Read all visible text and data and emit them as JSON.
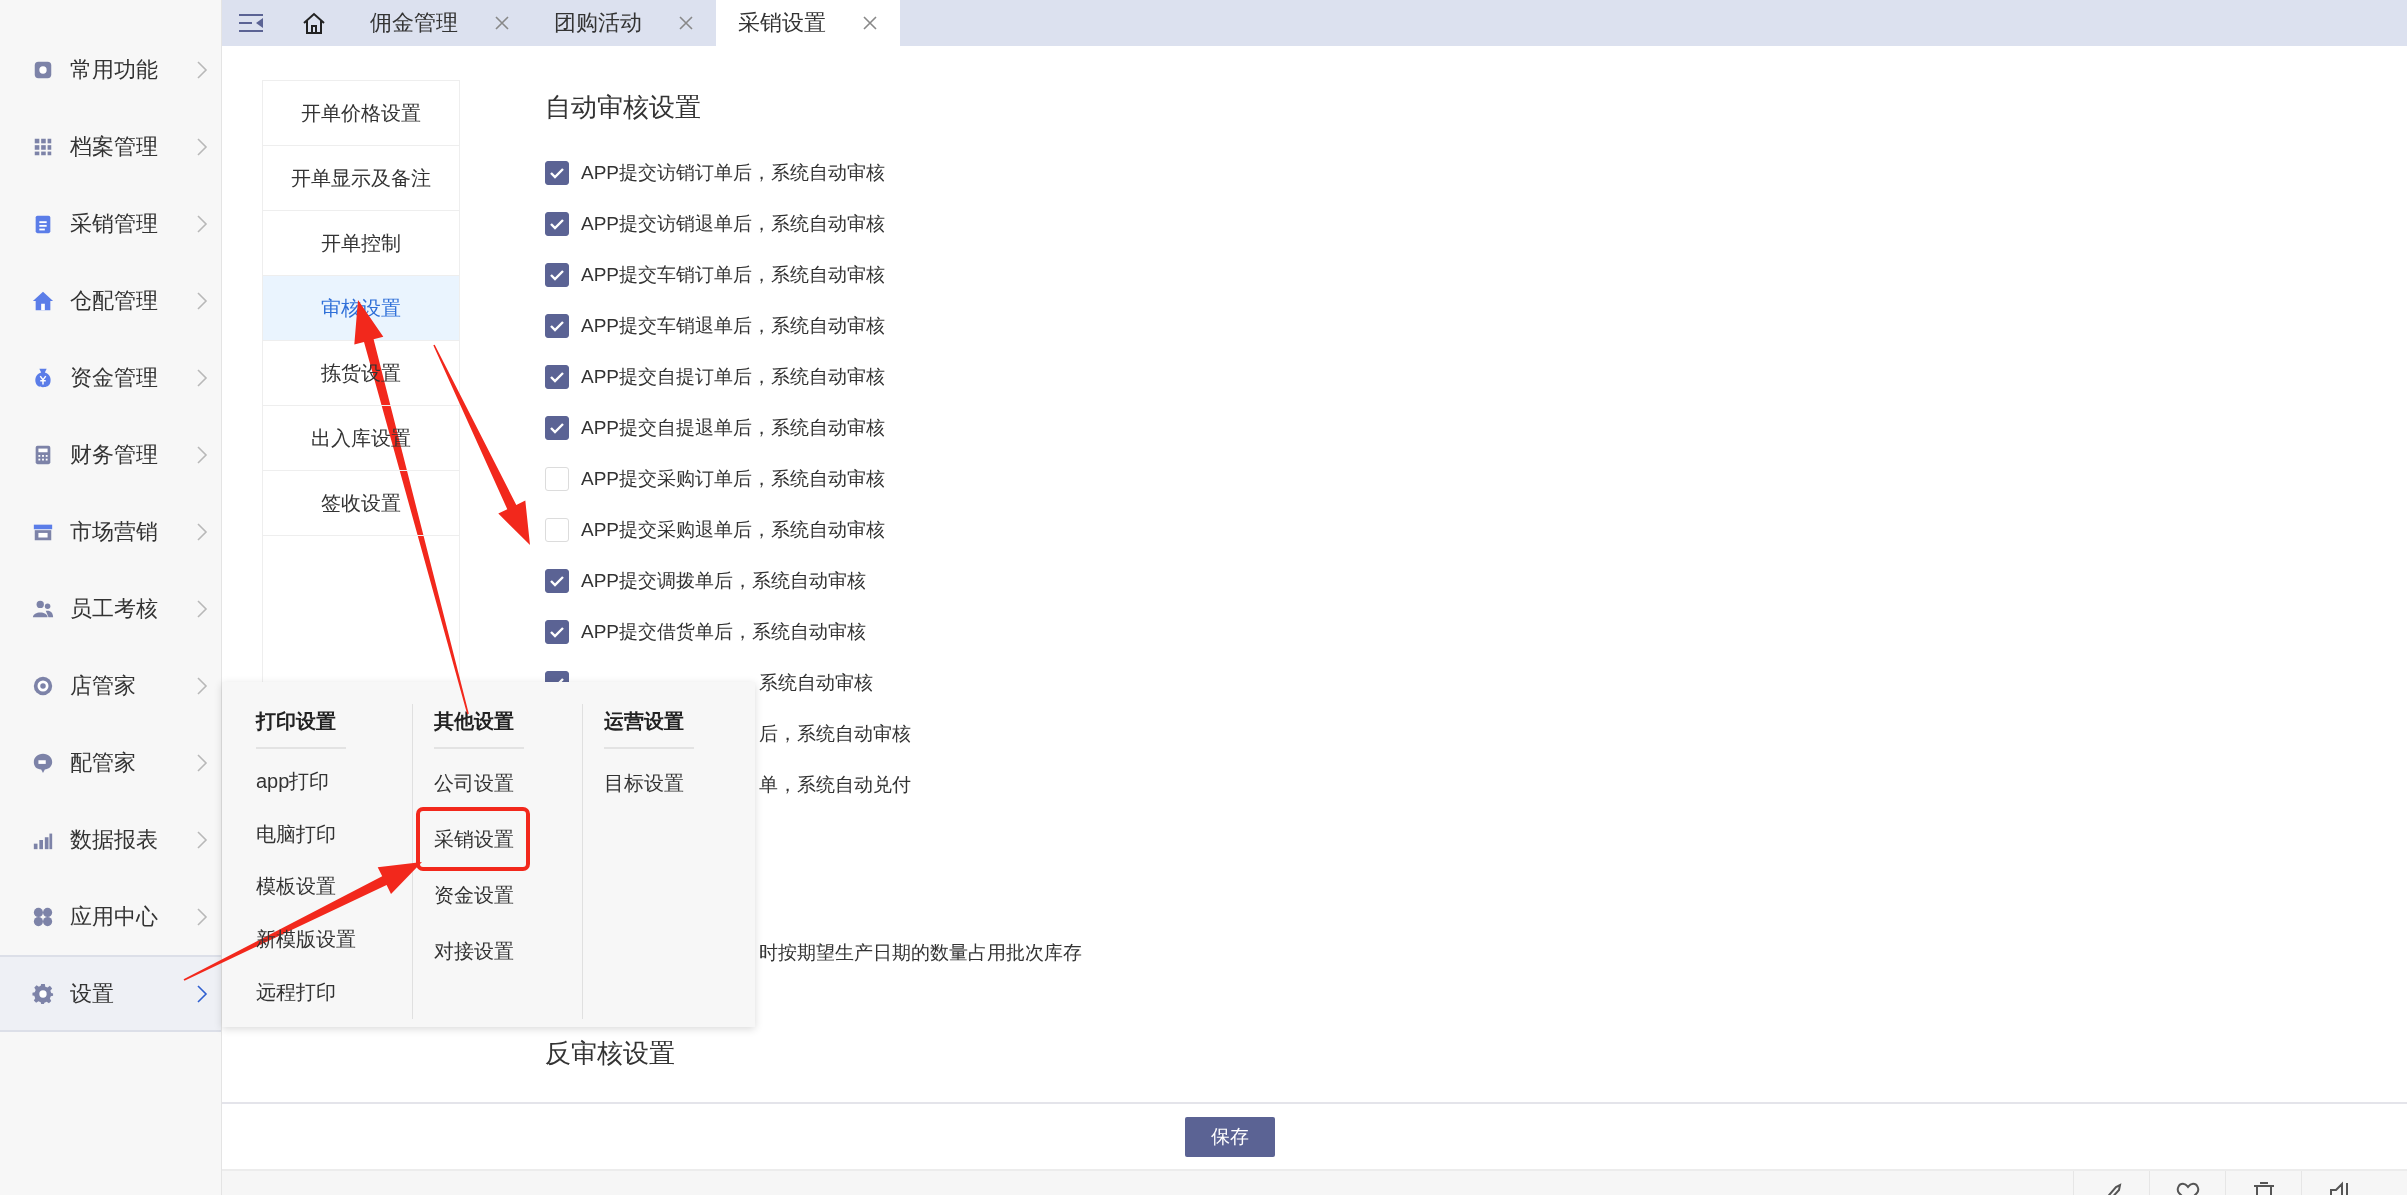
{
  "sidebar": {
    "items": [
      {
        "label": "常用功能",
        "selected": false
      },
      {
        "label": "档案管理",
        "selected": false
      },
      {
        "label": "采销管理",
        "selected": false
      },
      {
        "label": "仓配管理",
        "selected": false
      },
      {
        "label": "资金管理",
        "selected": false
      },
      {
        "label": "财务管理",
        "selected": false
      },
      {
        "label": "市场营销",
        "selected": false
      },
      {
        "label": "员工考核",
        "selected": false
      },
      {
        "label": "店管家",
        "selected": false
      },
      {
        "label": "配管家",
        "selected": false
      },
      {
        "label": "数据报表",
        "selected": false
      },
      {
        "label": "应用中心",
        "selected": false
      },
      {
        "label": "设置",
        "selected": true
      }
    ]
  },
  "tabs": [
    {
      "label": "佣金管理",
      "selected": false
    },
    {
      "label": "团购活动",
      "selected": false
    },
    {
      "label": "采销设置",
      "selected": true
    }
  ],
  "settings_nav": {
    "items": [
      {
        "label": "开单价格设置",
        "selected": false
      },
      {
        "label": "开单显示及备注",
        "selected": false
      },
      {
        "label": "开单控制",
        "selected": false
      },
      {
        "label": "审核设置",
        "selected": true
      },
      {
        "label": "拣货设置",
        "selected": false
      },
      {
        "label": "出入库设置",
        "selected": false
      },
      {
        "label": "签收设置",
        "selected": false
      }
    ]
  },
  "auto_review": {
    "title": "自动审核设置",
    "options": [
      {
        "kind": "checkbox",
        "label": "APP提交访销订单后，系统自动审核",
        "checked": true
      },
      {
        "kind": "checkbox",
        "label": "APP提交访销退单后，系统自动审核",
        "checked": true
      },
      {
        "kind": "checkbox",
        "label": "APP提交车销订单后，系统自动审核",
        "checked": true
      },
      {
        "kind": "checkbox",
        "label": "APP提交车销退单后，系统自动审核",
        "checked": true
      },
      {
        "kind": "checkbox",
        "label": "APP提交自提订单后，系统自动审核",
        "checked": true
      },
      {
        "kind": "checkbox",
        "label": "APP提交自提退单后，系统自动审核",
        "checked": true
      },
      {
        "kind": "checkbox",
        "label": "APP提交采购订单后，系统自动审核",
        "checked": false
      },
      {
        "kind": "checkbox",
        "label": "APP提交采购退单后，系统自动审核",
        "checked": false
      },
      {
        "kind": "checkbox",
        "label": "APP提交调拨单后，系统自动审核",
        "checked": true
      },
      {
        "kind": "checkbox",
        "label": "APP提交借货单后，系统自动审核",
        "checked": true
      },
      {
        "kind": "covered",
        "label": "系统自动审核",
        "checked": true
      },
      {
        "kind": "fragment",
        "label": "后，系统自动审核"
      },
      {
        "kind": "fragment",
        "label": "单，系统自动兑付"
      }
    ],
    "note_fragment": "时按期望生产日期的数量占用批次库存"
  },
  "reverse_review": {
    "title": "反审核设置"
  },
  "save_button": "保存",
  "settings_menu": {
    "columns": [
      {
        "heading": "打印设置",
        "items": [
          {
            "label": "app打印",
            "highlighted": false
          },
          {
            "label": "电脑打印",
            "highlighted": false
          },
          {
            "label": "模板设置",
            "highlighted": false
          },
          {
            "label": "新模版设置",
            "highlighted": false
          },
          {
            "label": "远程打印",
            "highlighted": false
          }
        ]
      },
      {
        "heading": "其他设置",
        "items": [
          {
            "label": "公司设置",
            "highlighted": false
          },
          {
            "label": "采销设置",
            "highlighted": true
          },
          {
            "label": "资金设置",
            "highlighted": false
          },
          {
            "label": "对接设置",
            "highlighted": false
          }
        ]
      },
      {
        "heading": "运营设置",
        "items": [
          {
            "label": "目标设置",
            "highlighted": false
          }
        ]
      }
    ]
  }
}
